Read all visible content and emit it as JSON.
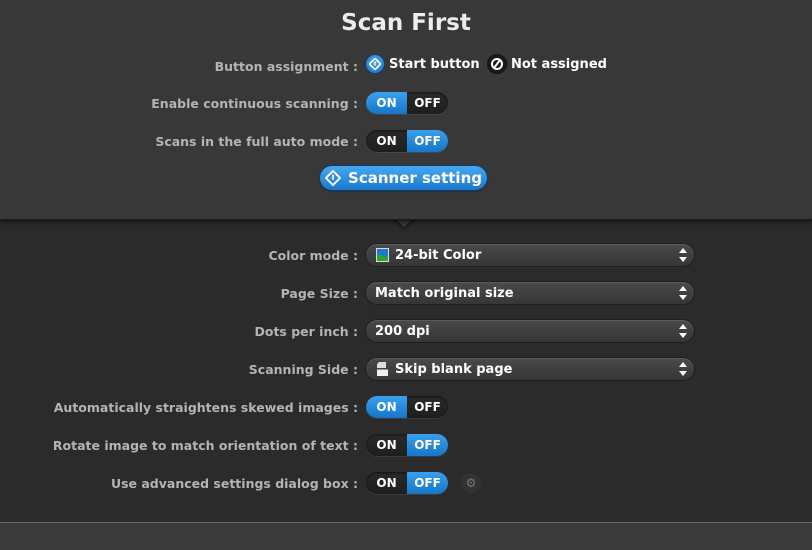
{
  "header": {
    "title": "Scan First"
  },
  "button_assignment": {
    "label": "Button assignment :",
    "options": [
      {
        "label": "Start button",
        "icon": "start-button-icon",
        "selected": true
      },
      {
        "label": "Not assigned",
        "icon": "not-assigned-icon",
        "selected": false
      }
    ]
  },
  "continuous_scanning": {
    "label": "Enable continuous scanning :",
    "on": "ON",
    "off": "OFF",
    "value": "ON"
  },
  "full_auto": {
    "label": "Scans in the full auto mode :",
    "on": "ON",
    "off": "OFF",
    "value": "OFF"
  },
  "scanner_setting_button": {
    "label": "Scanner setting",
    "icon": "start-button-icon"
  },
  "settings": {
    "color_mode": {
      "label": "Color mode :",
      "value": "24-bit Color",
      "icon": "color-image-icon"
    },
    "page_size": {
      "label": "Page Size :",
      "value": "Match original size"
    },
    "dpi": {
      "label": "Dots per inch :",
      "value": "200 dpi"
    },
    "scanning_side": {
      "label": "Scanning Side :",
      "value": "Skip blank page",
      "icon": "skip-blank-page-icon"
    },
    "straighten": {
      "label": "Automatically straightens skewed images :",
      "on": "ON",
      "off": "OFF",
      "value": "ON"
    },
    "rotate": {
      "label": "Rotate image to match orientation of text :",
      "on": "ON",
      "off": "OFF",
      "value": "OFF"
    },
    "advanced": {
      "label": "Use advanced settings dialog box :",
      "on": "ON",
      "off": "OFF",
      "value": "OFF",
      "icon": "gear-icon"
    }
  },
  "colors": {
    "accent": "#1f86d8",
    "background": "#2c2c2c",
    "panel": "#383838"
  }
}
